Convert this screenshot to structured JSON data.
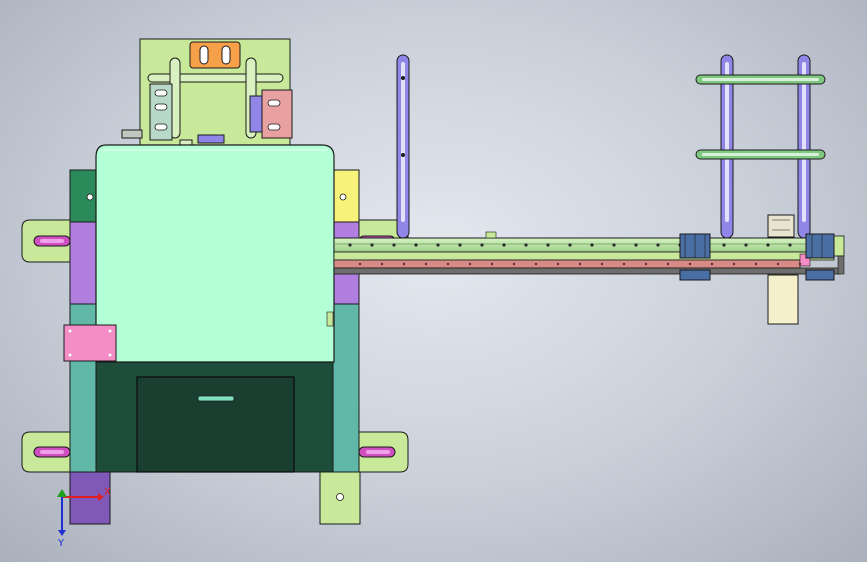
{
  "view": {
    "background_top": "#e4e8ef",
    "background_edge": "#a9b0bc"
  },
  "colors": {
    "light_green": "#b3ffd6",
    "lime": "#c8e89a",
    "dark_green": "#1e4d3b",
    "teal": "#62b8a8",
    "purple": "#b07fe0",
    "violet_slide": "#8f86e8",
    "pink": "#f48cc6",
    "salmon": "#e8a0a0",
    "orange": "#f7a04a",
    "yellow": "#f6f27a",
    "cream": "#f4f0cc",
    "rail_green": "#b9e8a0",
    "rail_red": "#d88a86",
    "motor_blue": "#4a6fa5",
    "magenta_pin": "#d04fc0",
    "outline": "#1a1a1a"
  },
  "axis_triad": {
    "x_label": "X",
    "y_label": "Y",
    "x_color": "#e02020",
    "y_color": "#2030d0",
    "origin_color": "#20a020"
  }
}
